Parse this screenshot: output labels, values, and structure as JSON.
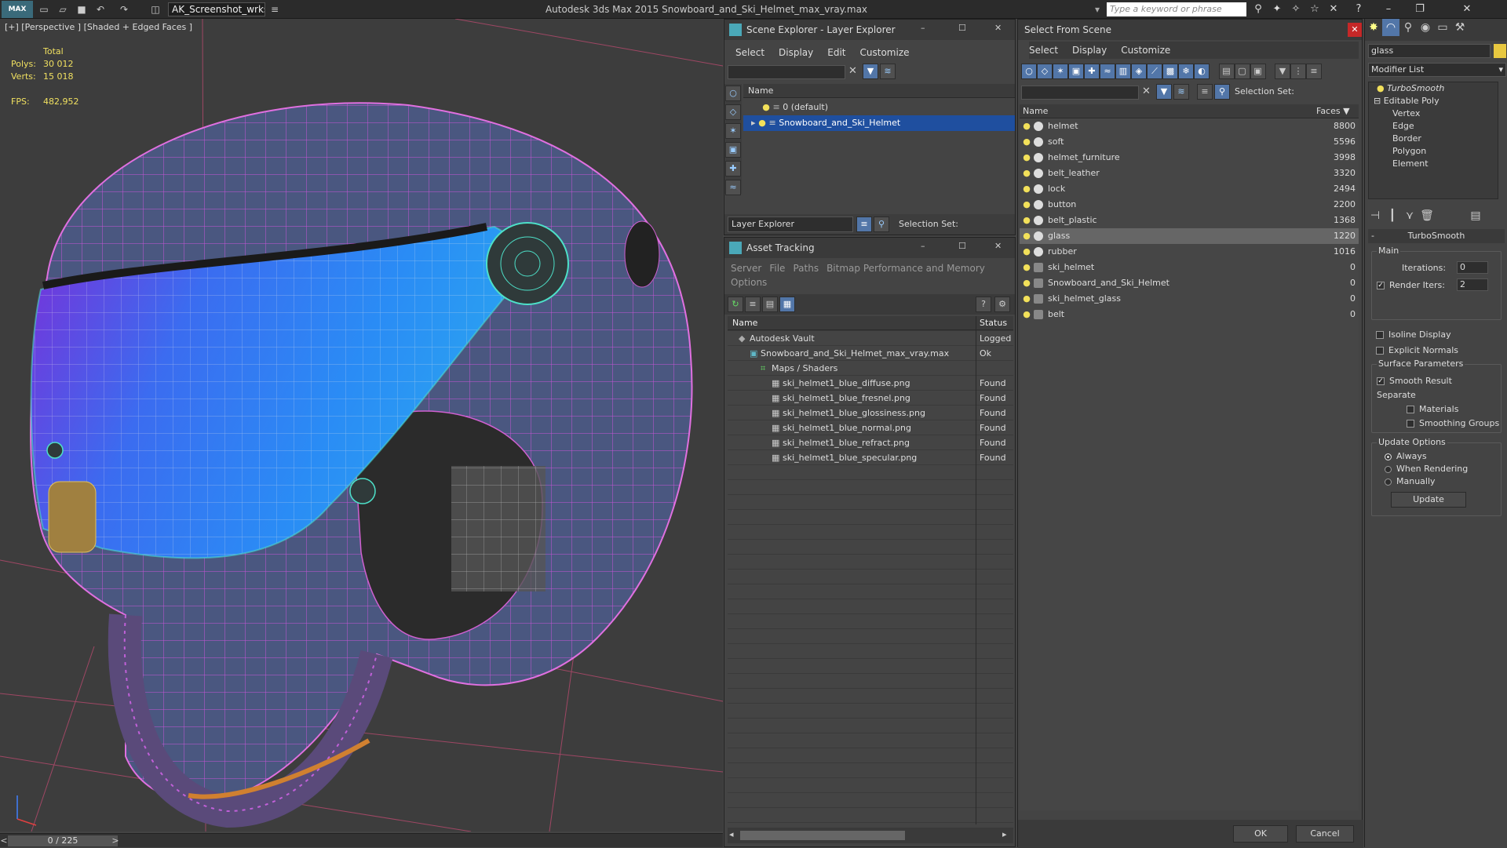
{
  "titlebar": {
    "logo": "MAX",
    "workspace": "AK_Screenshot_wrksp",
    "app_title": "Autodesk 3ds Max  2015    Snowboard_and_Ski_Helmet_max_vray.max",
    "search_placeholder": "Type a keyword or phrase"
  },
  "viewport": {
    "label": "[+] [Perspective ] [Shaded + Edged Faces ]",
    "stats_total": "Total",
    "polys_label": "Polys:",
    "polys_value": "30 012",
    "verts_label": "Verts:",
    "verts_value": "15 018",
    "fps_label": "FPS:",
    "fps_value": "482,952"
  },
  "timeline": {
    "frame": "0 / 225",
    "prev": "<",
    "next": ">"
  },
  "scene_explorer": {
    "title": "Scene Explorer - Layer Explorer",
    "menu": [
      "Select",
      "Display",
      "Edit",
      "Customize"
    ],
    "col_name": "Name",
    "rows": [
      "0 (default)",
      "Snowboard_and_Ski_Helmet"
    ],
    "footer_dropdown": "Layer Explorer",
    "selection_set": "Selection Set:"
  },
  "asset_tracking": {
    "title": "Asset Tracking",
    "menu_row1": [
      "Server",
      "File",
      "Paths",
      "Bitmap Performance and Memory"
    ],
    "menu_row2": [
      "Options"
    ],
    "col_name": "Name",
    "col_status": "Status",
    "rows": [
      {
        "name": "Autodesk Vault",
        "status": "Logged"
      },
      {
        "name": "Snowboard_and_Ski_Helmet_max_vray.max",
        "status": "Ok"
      },
      {
        "name": "Maps / Shaders",
        "status": ""
      },
      {
        "name": "ski_helmet1_blue_diffuse.png",
        "status": "Found"
      },
      {
        "name": "ski_helmet1_blue_fresnel.png",
        "status": "Found"
      },
      {
        "name": "ski_helmet1_blue_glossiness.png",
        "status": "Found"
      },
      {
        "name": "ski_helmet1_blue_normal.png",
        "status": "Found"
      },
      {
        "name": "ski_helmet1_blue_refract.png",
        "status": "Found"
      },
      {
        "name": "ski_helmet1_blue_specular.png",
        "status": "Found"
      }
    ]
  },
  "select_from_scene": {
    "title": "Select From Scene",
    "menu": [
      "Select",
      "Display",
      "Customize"
    ],
    "selection_set": "Selection Set:",
    "col_name": "Name",
    "col_faces": "Faces",
    "rows": [
      {
        "name": "helmet",
        "faces": "8800"
      },
      {
        "name": "soft",
        "faces": "5596"
      },
      {
        "name": "helmet_furniture",
        "faces": "3998"
      },
      {
        "name": "belt_leather",
        "faces": "3320"
      },
      {
        "name": "lock",
        "faces": "2494"
      },
      {
        "name": "button",
        "faces": "2200"
      },
      {
        "name": "belt_plastic",
        "faces": "1368"
      },
      {
        "name": "glass",
        "faces": "1220"
      },
      {
        "name": "rubber",
        "faces": "1016"
      },
      {
        "name": "ski_helmet",
        "faces": "0"
      },
      {
        "name": "Snowboard_and_Ski_Helmet",
        "faces": "0"
      },
      {
        "name": "ski_helmet_glass",
        "faces": "0"
      },
      {
        "name": "belt",
        "faces": "0"
      }
    ],
    "ok": "OK",
    "cancel": "Cancel"
  },
  "modifier_panel": {
    "object_name": "glass",
    "modifier_list": "Modifier List",
    "stack": [
      "TurboSmooth",
      "Editable Poly",
      "Vertex",
      "Edge",
      "Border",
      "Polygon",
      "Element"
    ],
    "rollout_title": "TurboSmooth",
    "main_label": "Main",
    "iterations_label": "Iterations:",
    "iterations_value": "0",
    "render_iters_label": "Render Iters:",
    "render_iters_value": "2",
    "isoline": "Isoline Display",
    "explicit_normals": "Explicit Normals",
    "surface_params": "Surface Parameters",
    "smooth_result": "Smooth Result",
    "separate": "Separate",
    "materials": "Materials",
    "smoothing_groups": "Smoothing Groups",
    "update_options": "Update Options",
    "always": "Always",
    "when_rendering": "When Rendering",
    "manually": "Manually",
    "update_button": "Update"
  }
}
